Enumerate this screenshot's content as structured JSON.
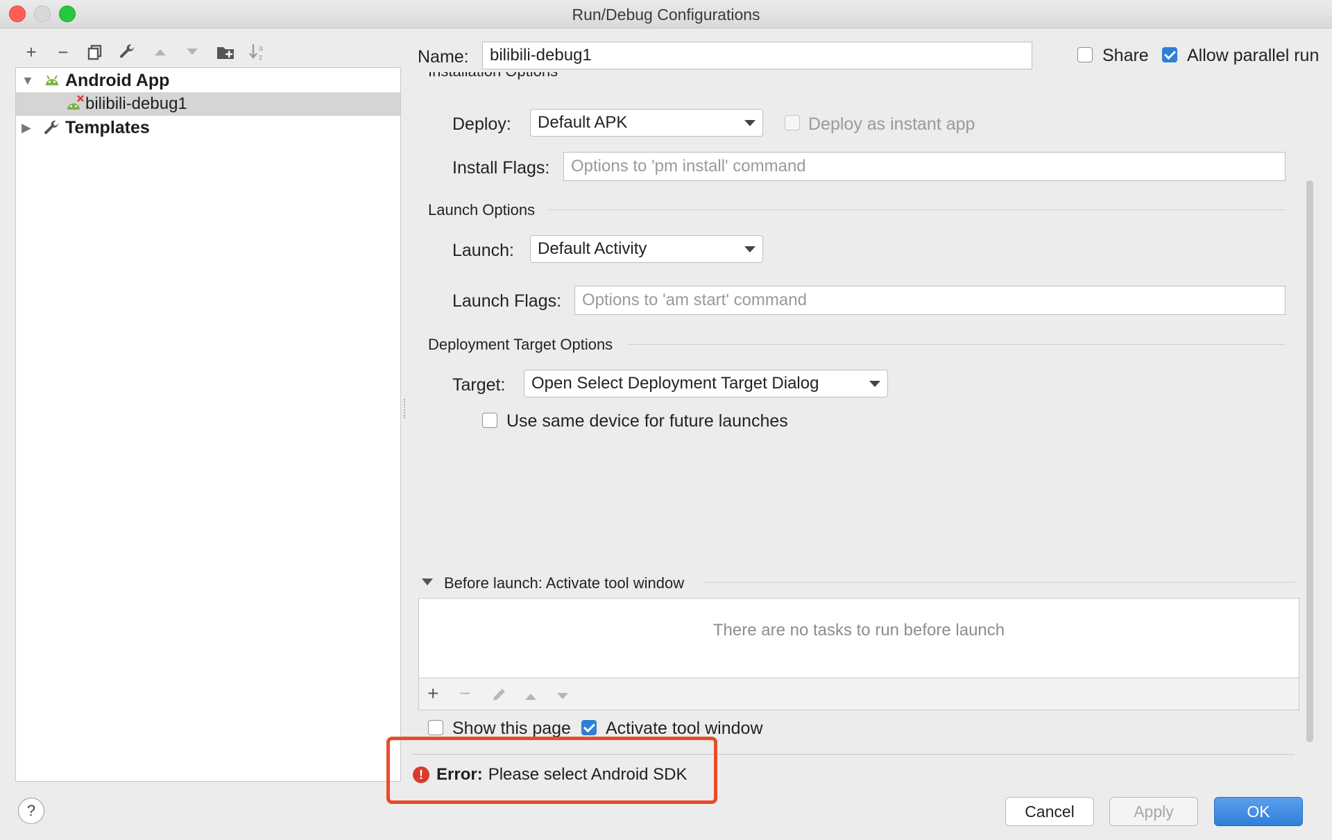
{
  "window": {
    "title": "Run/Debug Configurations"
  },
  "tree": {
    "items": [
      {
        "label": "Android App"
      },
      {
        "label": "bilibili-debug1"
      },
      {
        "label": "Templates"
      }
    ]
  },
  "form": {
    "name_label": "Name:",
    "name_value": "bilibili-debug1",
    "share_label": "Share",
    "allow_parallel_label": "Allow parallel run",
    "installation_section": "Installation Options",
    "deploy_label": "Deploy:",
    "deploy_value": "Default APK",
    "deploy_instant_label": "Deploy as instant app",
    "install_flags_label": "Install Flags:",
    "install_flags_placeholder": "Options to 'pm install' command",
    "launch_section": "Launch Options",
    "launch_label": "Launch:",
    "launch_value": "Default Activity",
    "launch_flags_label": "Launch Flags:",
    "launch_flags_placeholder": "Options to 'am start' command",
    "deployment_section": "Deployment Target Options",
    "target_label": "Target:",
    "target_value": "Open Select Deployment Target Dialog",
    "same_device_label": "Use same device for future launches",
    "before_launch_label": "Before launch: Activate tool window",
    "no_tasks_text": "There are no tasks to run before launch",
    "show_page_label": "Show this page",
    "activate_tool_label": "Activate tool window"
  },
  "error": {
    "prefix": "Error:",
    "message": "Please select Android SDK"
  },
  "buttons": {
    "help": "?",
    "cancel": "Cancel",
    "apply": "Apply",
    "ok": "OK"
  },
  "colors": {
    "accent": "#2f7ed8",
    "error": "#d93a2e",
    "highlight": "#ea4b2a"
  }
}
